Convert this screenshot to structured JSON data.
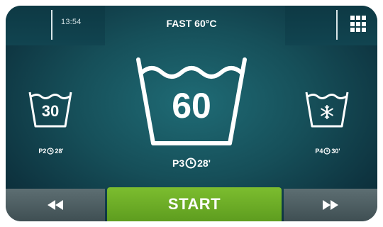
{
  "header": {
    "time": "13:54",
    "program_title": "FAST 60°C",
    "menu_icon": "grid-menu-icon"
  },
  "programs": [
    {
      "id": "P2",
      "temperature": "30",
      "symbol": "",
      "duration": "28'",
      "label_prefix": "P2"
    },
    {
      "id": "P3",
      "temperature": "60",
      "symbol": "",
      "duration": "28'",
      "label_prefix": "P3",
      "selected": true
    },
    {
      "id": "P4",
      "temperature": "",
      "symbol": "snowflake-icon",
      "duration": "30'",
      "label_prefix": "P4"
    }
  ],
  "footer": {
    "start_label": "START",
    "prev_icon": "rewind-icon",
    "next_icon": "fast-forward-icon"
  },
  "colors": {
    "screen_bg": "#164f59",
    "start_green": "#6fae27",
    "side_button_gray": "#4f5f63",
    "text": "#ffffff"
  }
}
